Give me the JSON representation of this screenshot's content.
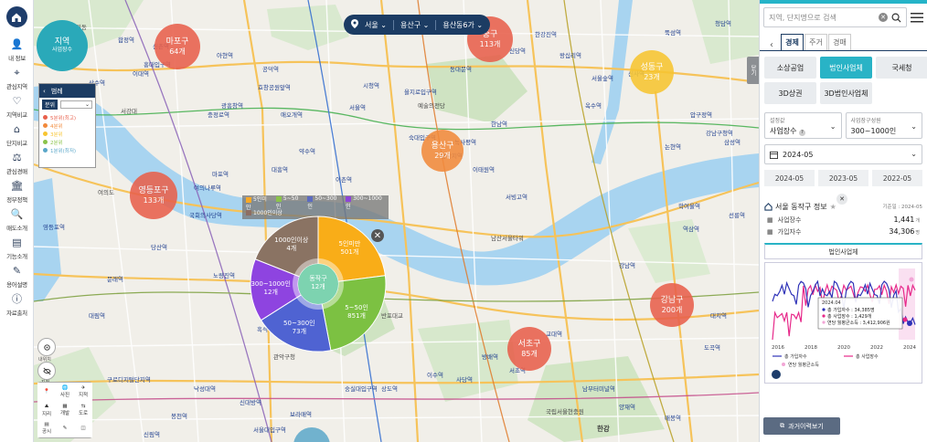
{
  "nav": {
    "items": [
      {
        "label": "내 정보",
        "icon": "user-icon"
      },
      {
        "label": "관심지역",
        "icon": "pin-icon"
      },
      {
        "label": "지역비교",
        "icon": "compare-icon"
      },
      {
        "label": "단지비교",
        "icon": "building-compare-icon"
      },
      {
        "label": "관심경매",
        "icon": "gavel-icon"
      },
      {
        "label": "정부정책",
        "icon": "government-icon"
      },
      {
        "label": "매도소개",
        "icon": "search-doc-icon"
      },
      {
        "label": "기능소개",
        "icon": "book-icon"
      },
      {
        "label": "용어설명",
        "icon": "edit-icon"
      },
      {
        "label": "자료출처",
        "icon": "info-icon"
      }
    ]
  },
  "selector": {
    "city": "서울",
    "district": "용산구",
    "dong": "용산동6가"
  },
  "legend": {
    "title": "범례",
    "subtitle": "분위",
    "select": "",
    "items": [
      {
        "label": "5분위(최고)",
        "color": "#e8604c"
      },
      {
        "label": "4분위",
        "color": "#f28a3c"
      },
      {
        "label": "3분위",
        "color": "#f7c531"
      },
      {
        "label": "2분위",
        "color": "#8bc34a"
      },
      {
        "label": "1분위(최저)",
        "color": "#5aa7c9"
      }
    ]
  },
  "region_bubble": {
    "line1": "지역",
    "line2": "사업장수"
  },
  "bubbles": [
    {
      "name": "마포구",
      "count": "64개",
      "color": "#e8604c"
    },
    {
      "name": "중구",
      "count": "113개",
      "color": "#e8604c"
    },
    {
      "name": "성동구",
      "count": "23개",
      "color": "#f7c531"
    },
    {
      "name": "용산구",
      "count": "29개",
      "color": "#f28a3c"
    },
    {
      "name": "영등포구",
      "count": "133개",
      "color": "#e8604c"
    },
    {
      "name": "강남구",
      "count": "200개",
      "color": "#e8604c"
    },
    {
      "name": "서초구",
      "count": "85개",
      "color": "#e8604c"
    }
  ],
  "donut_legend": {
    "items": [
      {
        "label": "5인미만",
        "color": "#f9a825"
      },
      {
        "label": "5~50인",
        "color": "#8bc34a"
      },
      {
        "label": "50~300인",
        "color": "#5c6bc0"
      },
      {
        "label": "300~1000인",
        "color": "#8e44d8"
      },
      {
        "label": "1000인이상",
        "color": "#8d6e63"
      }
    ]
  },
  "donut": {
    "center_name": "동작구",
    "center_count": "12개",
    "segments": [
      {
        "label": "5인미만",
        "count": "501개",
        "value": 501,
        "color": "#f9ad18"
      },
      {
        "label": "5~50인",
        "count": "851개",
        "value": 851,
        "color": "#7cc142"
      },
      {
        "label": "50~300인",
        "count": "73개",
        "value": 73,
        "color": "#4f63d2"
      },
      {
        "label": "300~1000인",
        "count": "12개",
        "value": 12,
        "color": "#8e44e0"
      },
      {
        "label": "1000인이상",
        "count": "4개",
        "value": 4,
        "color": "#8a7363"
      }
    ]
  },
  "map_places": [
    "망원동",
    "합정역",
    "서강대",
    "여의도",
    "영등포역",
    "노량진역",
    "흑석역",
    "동작역",
    "이촌역",
    "서빙고역",
    "한남역",
    "옥수역",
    "압구정역",
    "신사역",
    "논현역",
    "강남구청역",
    "삼성역",
    "선릉역",
    "역삼역",
    "강남역",
    "교대역",
    "서초역",
    "방배역",
    "사당역",
    "이수역",
    "상도역",
    "숭실대입구역",
    "신대방역",
    "보라매역",
    "신림역",
    "봉천역",
    "서울대입구역",
    "낙성대역",
    "남부터미널역",
    "양재역",
    "매봉역",
    "도곡역",
    "대치역",
    "학여울역",
    "청담역",
    "뚝섬역",
    "서울숲역",
    "왕십리역",
    "신당역",
    "동대문역",
    "을지로입구역",
    "시청역",
    "서울역",
    "숙대입구역",
    "삼각지역",
    "녹사평역",
    "이태원역",
    "한강진역",
    "약수역",
    "효창공원앞역",
    "공덕역",
    "애오개역",
    "충정로역",
    "아현역",
    "신촌역",
    "이대역",
    "홍대입구역",
    "상수역",
    "광흥창역",
    "대흥역",
    "마포역",
    "여의나루역",
    "국회의사당역",
    "당산역",
    "문래역",
    "대림역",
    "구로디지털단지역",
    "관악구청",
    "반포대교",
    "한강대교",
    "국립서울현충원",
    "예술의전당",
    "남산서울타워",
    "한강"
  ],
  "map_tools": {
    "location": "내위치",
    "cadastral": "지적",
    "t1": "사진",
    "t2": "지적",
    "t3": "지리",
    "t4": "개발",
    "t5": "도로",
    "t6": "공시"
  },
  "right_tab": "닫기",
  "panel": {
    "search_placeholder": "지역, 단지명으로 검색",
    "tabs": [
      "경제",
      "주거",
      "경매"
    ],
    "active_tab": "경제",
    "sources": [
      "소상공업",
      "법인사업체",
      "국세청",
      "3D상권",
      "3D법인사업체"
    ],
    "active_source": "법인사업체",
    "filter1": {
      "label": "설정값",
      "value": "사업장수"
    },
    "filter2": {
      "label": "사업장구성원",
      "value": "300~1000인"
    },
    "month": "2024-05",
    "months": [
      "2024-05",
      "2023-05",
      "2022-05"
    ],
    "info_title": "서울 동작구 정보",
    "info_ref": "기준일 : 2024-05",
    "stats": [
      {
        "label": "사업장수",
        "value": "1,441",
        "unit": "개"
      },
      {
        "label": "가입자수",
        "value": "34,306",
        "unit": "명"
      }
    ],
    "chart_tab": "법인사업체",
    "report_btn": "과거이력보기"
  },
  "chart_data": {
    "type": "line",
    "x_ticks": [
      "2016",
      "2018",
      "2020",
      "2022",
      "2024"
    ],
    "tooltip": {
      "date": "2024.04",
      "lines": [
        "총 가입자수 : 34,385명",
        "총 사업장수 : 1,429개",
        "연당 월평균소득 : 3,412,906원"
      ]
    },
    "series": [
      {
        "name": "총 가입자수",
        "color": "#2f33b8"
      },
      {
        "name": "총 사업장수",
        "color": "#e7298a"
      },
      {
        "name": "연당 월평균소득",
        "color": "#f2a6d6"
      }
    ]
  }
}
